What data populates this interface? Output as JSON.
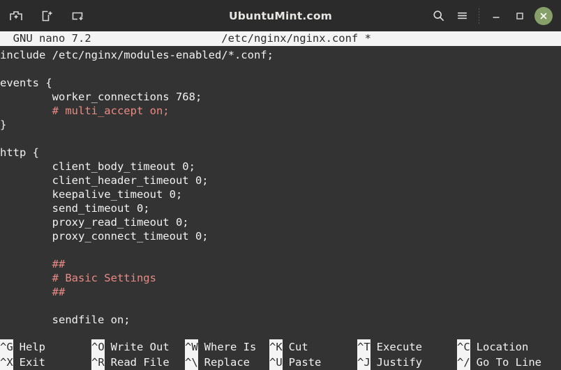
{
  "titlebar": {
    "title": "UbuntuMint.com",
    "left_icons": [
      {
        "name": "new-tab-icon",
        "label": "New Tab"
      },
      {
        "name": "new-window-icon",
        "label": "New Window"
      },
      {
        "name": "split-pane-icon",
        "label": "Split Pane"
      }
    ],
    "right_icons": [
      {
        "name": "search-icon",
        "label": "Search"
      },
      {
        "name": "menu-icon",
        "label": "Menu"
      }
    ],
    "window_controls": [
      {
        "name": "minimize-button",
        "glyph": "—"
      },
      {
        "name": "maximize-button",
        "glyph": "□"
      },
      {
        "name": "close-button",
        "glyph": "✕"
      }
    ],
    "close_button_color": "#87a06a"
  },
  "editor": {
    "header_left": "  GNU nano 7.2",
    "header_center": "/etc/nginx/nginx.conf *",
    "header_text": "  GNU nano 7.2                    /etc/nginx/nginx.conf *",
    "version": "GNU nano 7.2",
    "filename": "/etc/nginx/nginx.conf",
    "modified_marker": "*",
    "lines": [
      {
        "text": "include /etc/nginx/modules-enabled/*.conf;",
        "type": "code"
      },
      {
        "text": "",
        "type": "blank"
      },
      {
        "text": "events {",
        "type": "code"
      },
      {
        "text": "        worker_connections 768;",
        "type": "code"
      },
      {
        "text": "        # multi_accept on;",
        "type": "comment"
      },
      {
        "text": "}",
        "type": "code"
      },
      {
        "text": "",
        "type": "blank"
      },
      {
        "text": "http {",
        "type": "code"
      },
      {
        "text": "        client_body_timeout 0;",
        "type": "code"
      },
      {
        "text": "        client_header_timeout 0;",
        "type": "code"
      },
      {
        "text": "        keepalive_timeout 0;",
        "type": "code"
      },
      {
        "text": "        send_timeout 0;",
        "type": "code"
      },
      {
        "text": "        proxy_read_timeout 0;",
        "type": "code"
      },
      {
        "text": "        proxy_connect_timeout 0;",
        "type": "code"
      },
      {
        "text": "",
        "type": "blank"
      },
      {
        "text": "        ##",
        "type": "comment"
      },
      {
        "text": "        # Basic Settings",
        "type": "comment"
      },
      {
        "text": "        ##",
        "type": "comment"
      },
      {
        "text": "",
        "type": "blank"
      },
      {
        "text": "        sendfile on;",
        "type": "code"
      }
    ]
  },
  "shortcuts": {
    "row1": [
      {
        "key": "^G",
        "label": "Help"
      },
      {
        "key": "^O",
        "label": "Write Out"
      },
      {
        "key": "^W",
        "label": "Where Is"
      },
      {
        "key": "^K",
        "label": "Cut"
      },
      {
        "key": "^T",
        "label": "Execute"
      },
      {
        "key": "^C",
        "label": "Location"
      }
    ],
    "row2": [
      {
        "key": "^X",
        "label": "Exit"
      },
      {
        "key": "^R",
        "label": "Read File"
      },
      {
        "key": "^\\",
        "label": "Replace"
      },
      {
        "key": "^U",
        "label": "Paste"
      },
      {
        "key": "^J",
        "label": "Justify"
      },
      {
        "key": "^/",
        "label": "Go To Line"
      }
    ]
  }
}
